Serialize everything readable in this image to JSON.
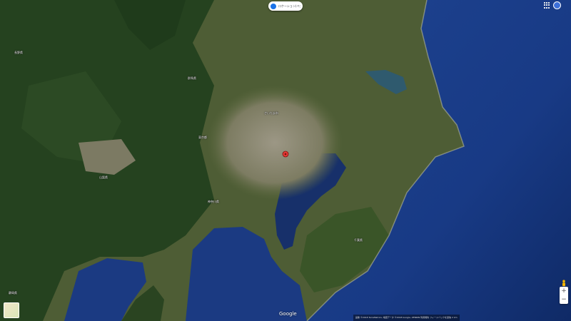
{
  "map": {
    "type": "satellite",
    "marker_color": "#e53935",
    "sea_color": "#1a3a7a",
    "ocean_deep_color": "#16347a",
    "bay_color": "#17306a",
    "land_color": "#4b5a35",
    "mountain_color": "#23411e",
    "urban_color": "#8a8675"
  },
  "top_chip": {
    "text": "ロケーション(ペグの場所)",
    "icon": "location-dot-icon"
  },
  "controls": {
    "apps_icon": "apps-grid-icon",
    "avatar_icon": "account-avatar-icon",
    "zoom_in": "+",
    "zoom_out": "−",
    "layer_icon": "layers-thumbnail-icon",
    "pegman_icon": "street-view-pegman-icon"
  },
  "google_logo": "Google",
  "attribution": "画像 ©2018 TerraMetrics, 地図データ ©2018 Google, ZENRIN  利用規約  フィードバックを送信  2 km",
  "labels": [
    {
      "id": "nagano",
      "text": "長野県"
    },
    {
      "id": "gunma",
      "text": "群馬県"
    },
    {
      "id": "saitama",
      "text": "さいたま市"
    },
    {
      "id": "tokyo",
      "text": "東京都"
    },
    {
      "id": "yamanashi",
      "text": "山梨県"
    },
    {
      "id": "kanagawa",
      "text": "神奈川県"
    },
    {
      "id": "chiba",
      "text": "千葉県"
    },
    {
      "id": "shizuoka",
      "text": "静岡県"
    }
  ]
}
